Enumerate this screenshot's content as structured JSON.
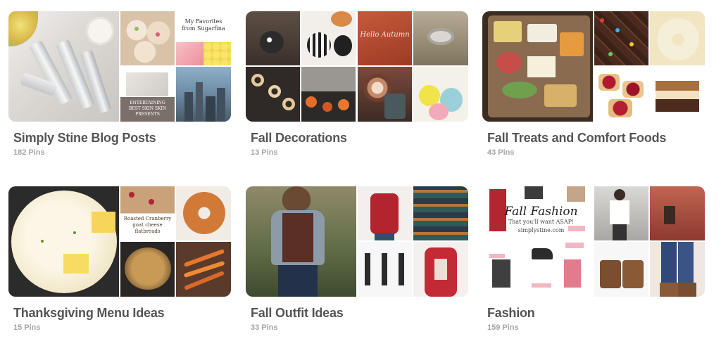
{
  "boards": [
    {
      "title": "Simply Stine Blog Posts",
      "pin_count": "182 Pins",
      "tile_texts": {
        "r1": "My Favorites from Sugarfina",
        "m2": "ENTERTAINING BEST SKIN SKIN PRESENTS"
      }
    },
    {
      "title": "Fall Decorations",
      "pin_count": "13 Pins",
      "tile_texts": {
        "m1": "Hello Autumn"
      }
    },
    {
      "title": "Fall Treats and Comfort Foods",
      "pin_count": "43 Pins",
      "tile_texts": {}
    },
    {
      "title": "Thanksgiving Menu Ideas",
      "pin_count": "15 Pins",
      "tile_texts": {
        "m1": "Roasted Cranberry goat cheese flatbreads"
      }
    },
    {
      "title": "Fall Outfit Ideas",
      "pin_count": "33 Pins",
      "tile_texts": {}
    },
    {
      "title": "Fashion",
      "pin_count": "159 Pins",
      "tile_texts": {
        "big_title": "Fall Fashion",
        "big_sub": "That you'll want ASAP!",
        "big_url": "simplystine.com"
      }
    }
  ]
}
